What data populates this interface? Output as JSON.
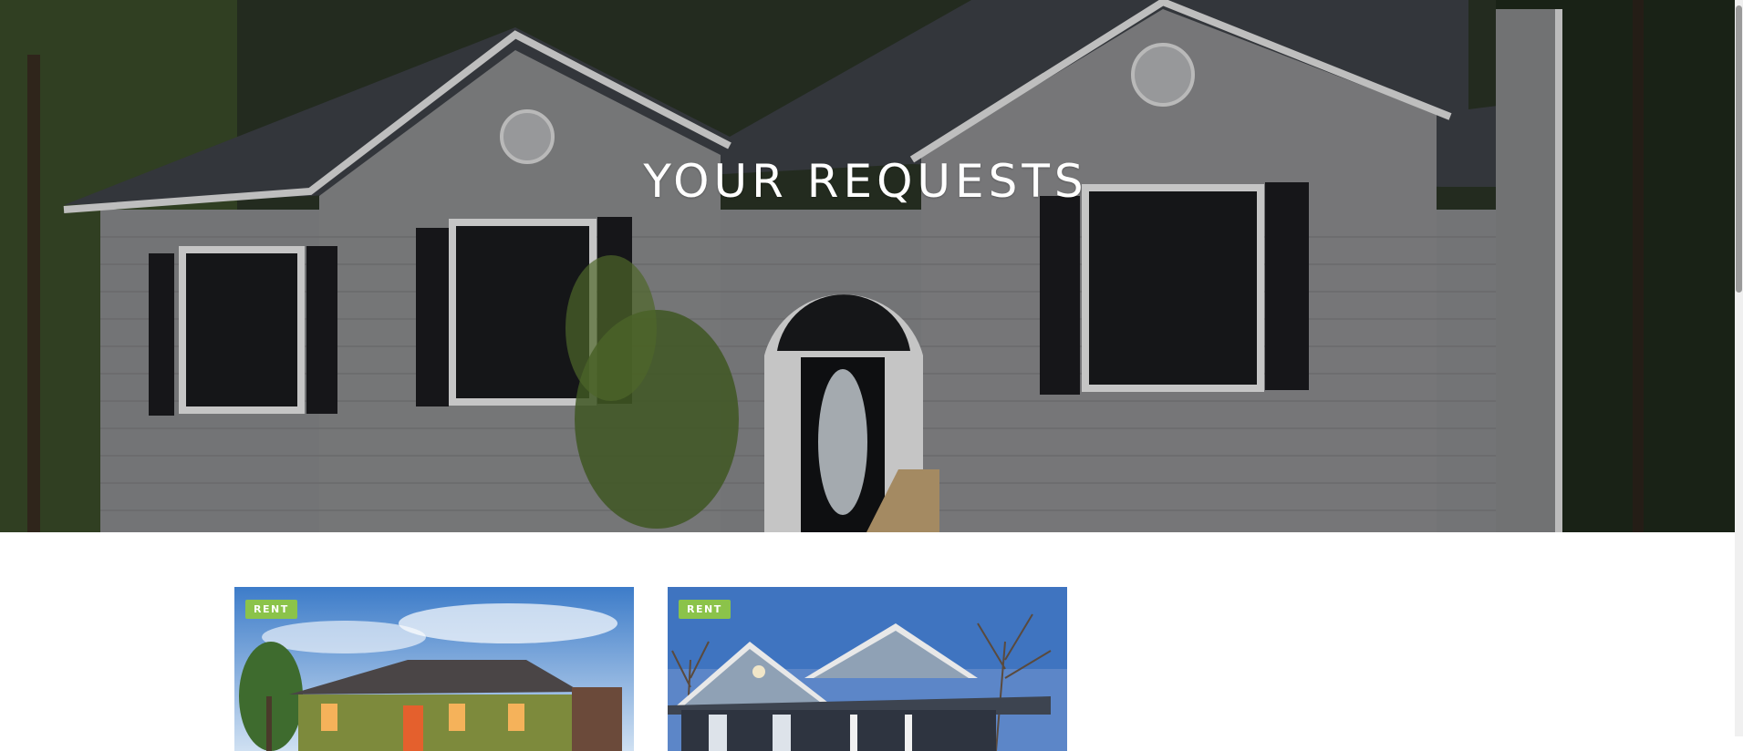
{
  "hero": {
    "title": "YOUR REQUESTS",
    "image": "gray-siding-house-photo"
  },
  "listings": [
    {
      "badge": "RENT",
      "image": "olive-house-sunset-photo"
    },
    {
      "badge": "RENT",
      "image": "blue-gray-house-photo"
    }
  ],
  "colors": {
    "badge": "#8bc34a",
    "title": "#ffffff"
  }
}
